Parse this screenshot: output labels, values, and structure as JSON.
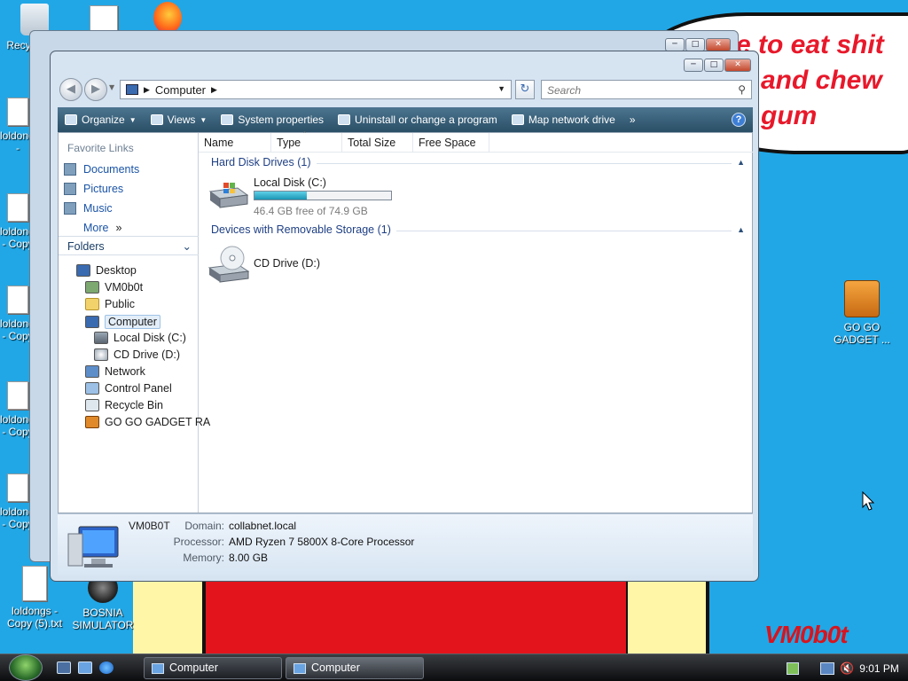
{
  "desktop": {
    "bubble_lines": [
      "e to eat shit",
      "and chew",
      "gum"
    ],
    "signature": "VM0b0t",
    "icons": [
      {
        "label": "Recycle Bin",
        "icon": "recycle-bin-icon"
      },
      {
        "label": "loldongs -",
        "icon": "text-file-icon"
      },
      {
        "label": "loldongs - Copy",
        "icon": "text-file-icon"
      },
      {
        "label": "loldongs - Copy",
        "icon": "text-file-icon"
      },
      {
        "label": "loldongs - Copy",
        "icon": "text-file-icon"
      },
      {
        "label": "loldongs - Copy",
        "icon": "text-file-icon"
      },
      {
        "label": "loldongs - Copy (5).txt",
        "icon": "text-file-icon"
      },
      {
        "label": "BOSNIA SIMULATOR",
        "icon": "bosnia-simulator-icon"
      },
      {
        "label": "GO GO GADGET ...",
        "icon": "briefcase-icon"
      }
    ]
  },
  "window": {
    "address_crumb": "Computer",
    "search_placeholder": "Search",
    "toolbar": {
      "organize": "Organize",
      "views": "Views",
      "system_properties": "System properties",
      "uninstall": "Uninstall or change a program",
      "map_drive": "Map network drive",
      "more": "»"
    },
    "favorite_links": {
      "header": "Favorite Links",
      "items": [
        "Documents",
        "Pictures",
        "Music"
      ],
      "more": "More",
      "more_glyph": "»"
    },
    "folders": {
      "header": "Folders",
      "items": [
        "Desktop",
        "VM0b0t",
        "Public",
        "Computer",
        "Local Disk (C:)",
        "CD Drive (D:)",
        "Network",
        "Control Panel",
        "Recycle Bin",
        "GO GO GADGET RA"
      ]
    },
    "columns": [
      "Name",
      "Type",
      "Total Size",
      "Free Space"
    ],
    "groups": {
      "hard_disk": "Hard Disk Drives (1)",
      "removable": "Devices with Removable Storage (1)"
    },
    "drives": {
      "c_label": "Local Disk (C:)",
      "c_free": "46.4 GB free of 74.9 GB",
      "c_used_fraction": 0.38,
      "d_label": "CD Drive (D:)"
    },
    "details": {
      "computer_name": "VM0B0T",
      "domain_label": "Domain:",
      "domain_value": "collabnet.local",
      "processor_label": "Processor:",
      "processor_value": "AMD Ryzen 7 5800X 8-Core Processor",
      "memory_label": "Memory:",
      "memory_value": "8.00 GB"
    }
  },
  "taskbar": {
    "tasks": [
      "Computer",
      "Computer"
    ],
    "clock": "9:01 PM"
  }
}
